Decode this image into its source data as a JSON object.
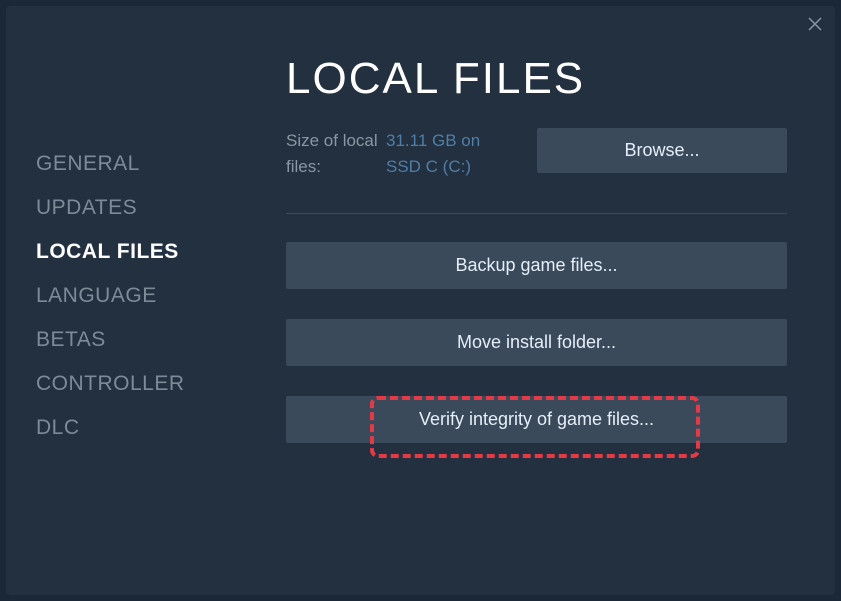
{
  "sidebar": {
    "items": [
      {
        "label": "GENERAL"
      },
      {
        "label": "UPDATES"
      },
      {
        "label": "LOCAL FILES"
      },
      {
        "label": "LANGUAGE"
      },
      {
        "label": "BETAS"
      },
      {
        "label": "CONTROLLER"
      },
      {
        "label": "DLC"
      }
    ],
    "activeIndex": 2
  },
  "main": {
    "title": "LOCAL FILES",
    "sizeLabel": "Size of local files:",
    "sizeValue": "31.11 GB on SSD C (C:)",
    "browseLabel": "Browse...",
    "actions": [
      {
        "label": "Backup game files..."
      },
      {
        "label": "Move install folder..."
      },
      {
        "label": "Verify integrity of game files..."
      }
    ]
  }
}
